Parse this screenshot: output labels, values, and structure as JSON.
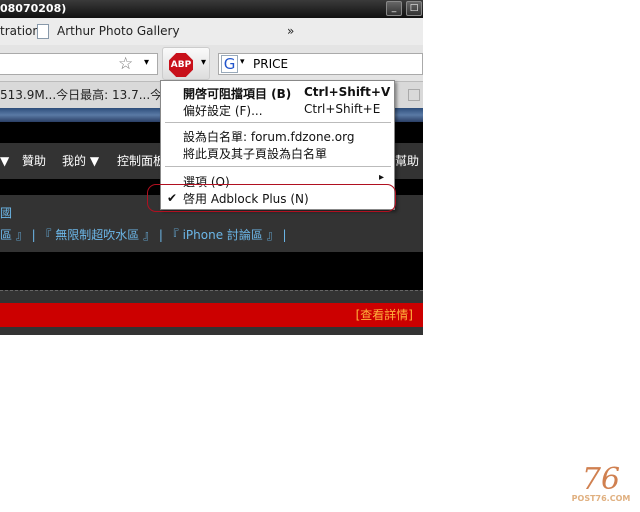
{
  "window": {
    "title": "08070208)",
    "minimize": "_",
    "restore": "□"
  },
  "bookmarks": {
    "items": [
      "tration",
      "Arthur Photo Gallery"
    ],
    "overflow": "»"
  },
  "navbar": {
    "bookmark_star": "☆",
    "dropdown": "▾",
    "abp_label": "ABP",
    "search_engine": "G",
    "search_value": "PRICE"
  },
  "ticker": {
    "text": "513.9M...今日最高: 13.7...今_"
  },
  "forum_menu": {
    "items": [
      "▼",
      "贊助",
      "我的 ▼",
      "控制面板",
      "幫助"
    ]
  },
  "forum_links": {
    "line1": "國",
    "line2": "區 』 | 『 無限制超吹水區 』 | 『 iPhone 討論區 』 |"
  },
  "banner": {
    "details_link": "[查看詳情]"
  },
  "abp_menu": {
    "items": [
      {
        "label": "開啓可阻擋項目 (B)",
        "shortcut": "Ctrl+Shift+V",
        "bold": true
      },
      {
        "label": "偏好設定 (F)...",
        "shortcut": "Ctrl+Shift+E"
      },
      {
        "label": "設為白名單: forum.fdzone.org"
      },
      {
        "label": "將此頁及其子頁設為白名單"
      },
      {
        "label": "選項 (O)",
        "submenu": "▸"
      },
      {
        "label": "啓用 Adblock Plus (N)",
        "checked": "✔"
      }
    ]
  },
  "watermark": {
    "number": "76",
    "site": "POST76.COM"
  },
  "colors": {
    "highlight_circle": "#b01020",
    "banner": "#cc0000",
    "link": "#6cb7e8"
  }
}
